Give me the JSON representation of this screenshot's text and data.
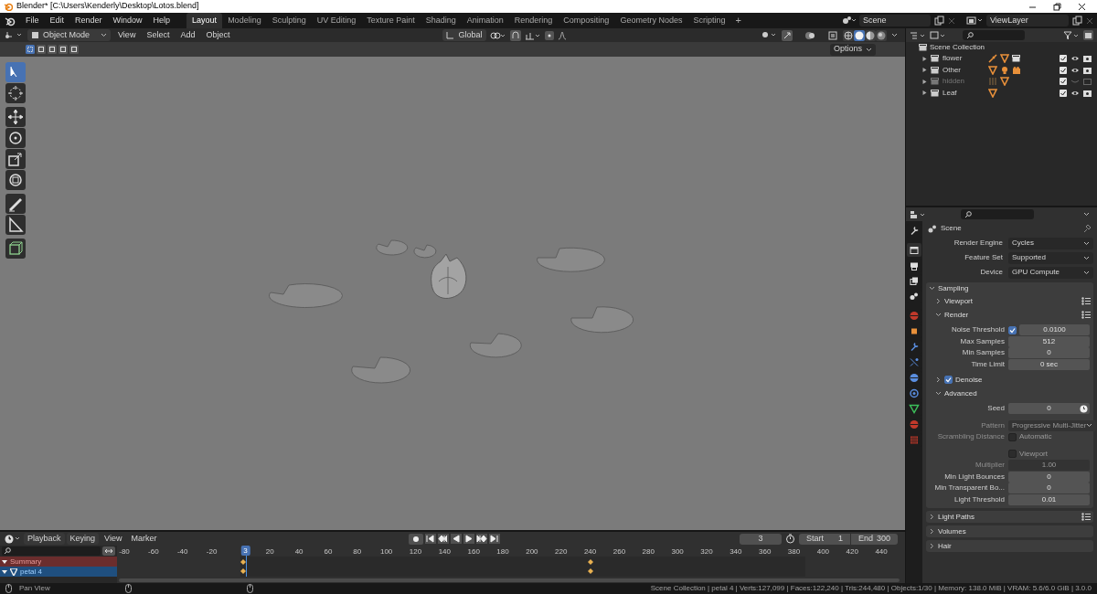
{
  "window": {
    "title": "Blender* [C:\\Users\\Kenderly\\Desktop\\Lotos.blend]"
  },
  "menus": [
    "File",
    "Edit",
    "Render",
    "Window",
    "Help"
  ],
  "workspaces": [
    {
      "label": "Layout",
      "selected": true
    },
    {
      "label": "Modeling",
      "selected": false
    },
    {
      "label": "Sculpting",
      "selected": false
    },
    {
      "label": "UV Editing",
      "selected": false
    },
    {
      "label": "Texture Paint",
      "selected": false
    },
    {
      "label": "Shading",
      "selected": false
    },
    {
      "label": "Animation",
      "selected": false
    },
    {
      "label": "Rendering",
      "selected": false
    },
    {
      "label": "Compositing",
      "selected": false
    },
    {
      "label": "Geometry Nodes",
      "selected": false
    },
    {
      "label": "Scripting",
      "selected": false
    }
  ],
  "add_workspace": "+",
  "scene": {
    "value": "Scene"
  },
  "view_layer": {
    "value": "ViewLayer"
  },
  "viewport": {
    "mode": "Object Mode",
    "menus": [
      "View",
      "Select",
      "Add",
      "Object"
    ],
    "orientation": "Global",
    "options": "Options",
    "select_modes": [
      {
        "selected": true
      },
      {
        "selected": false
      },
      {
        "selected": false
      },
      {
        "selected": false
      },
      {
        "selected": false
      }
    ],
    "shading_modes": [
      {
        "selected": false
      },
      {
        "selected": true
      },
      {
        "selected": false
      },
      {
        "selected": false
      }
    ],
    "tools": [
      {
        "kind": "select",
        "selected": true
      },
      {
        "kind": "cursor",
        "selected": false
      },
      {
        "kind": "move",
        "selected": false
      },
      {
        "kind": "rotate",
        "selected": false
      },
      {
        "kind": "scale",
        "selected": false
      },
      {
        "kind": "transform",
        "selected": false
      },
      {
        "kind": "annotate",
        "selected": false
      },
      {
        "kind": "measure",
        "selected": false
      },
      {
        "kind": "add-cube",
        "selected": false
      }
    ]
  },
  "outliner": {
    "root": "Scene Collection",
    "collections": [
      {
        "name": "flower",
        "expanded": false,
        "checked": true,
        "visible": true,
        "contents": [
          {
            "kind": "armature"
          },
          {
            "kind": "mesh"
          },
          {
            "kind": "collection"
          }
        ]
      },
      {
        "name": "Other",
        "expanded": false,
        "checked": true,
        "visible": true,
        "contents": [
          {
            "kind": "mesh"
          },
          {
            "kind": "light"
          },
          {
            "kind": "camera"
          }
        ]
      },
      {
        "name": "hidden",
        "expanded": false,
        "checked": true,
        "visible": false,
        "contents": [
          {
            "kind": "hair"
          },
          {
            "kind": "mesh"
          }
        ]
      },
      {
        "name": "Leaf",
        "expanded": false,
        "checked": true,
        "visible": true,
        "contents": [
          {
            "kind": "mesh"
          }
        ]
      }
    ]
  },
  "properties": {
    "tabs": [
      {
        "kind": "tool",
        "selected": false
      },
      {
        "kind": "render",
        "selected": true
      },
      {
        "kind": "output",
        "selected": false
      },
      {
        "kind": "view-layer",
        "selected": false
      },
      {
        "kind": "scene",
        "selected": false
      },
      {
        "kind": "world",
        "selected": false
      },
      {
        "kind": "object",
        "selected": false
      },
      {
        "kind": "modifiers",
        "selected": false
      },
      {
        "kind": "particles",
        "selected": false
      },
      {
        "kind": "physics",
        "selected": false
      },
      {
        "kind": "constraints",
        "selected": false
      },
      {
        "kind": "data",
        "selected": false
      },
      {
        "kind": "material",
        "selected": false
      },
      {
        "kind": "texture",
        "selected": false
      }
    ],
    "context": "Scene",
    "top_rows": [
      {
        "label": "Render Engine",
        "value": "Cycles"
      },
      {
        "label": "Feature Set",
        "value": "Supported"
      },
      {
        "label": "Device",
        "value": "GPU Compute"
      }
    ],
    "panels": [
      {
        "title": "Sampling",
        "expanded": true,
        "subpanels": [
          {
            "title": "Viewport",
            "expanded": false,
            "presets": true
          },
          {
            "title": "Render",
            "expanded": true,
            "presets": true,
            "rows": [
              {
                "kind": "check-number",
                "label": "Noise Threshold",
                "checked": true,
                "value": "0.0100",
                "disabled": false
              },
              {
                "kind": "number",
                "label": "Max Samples",
                "value": "512",
                "disabled": false
              },
              {
                "kind": "number",
                "label": "Min Samples",
                "value": "0",
                "disabled": false
              },
              {
                "kind": "number",
                "label": "Time Limit",
                "value": "0 sec",
                "disabled": false
              }
            ]
          },
          {
            "title": "Denoise",
            "expanded": false,
            "presets": false,
            "checked": true
          },
          {
            "title": "Advanced",
            "expanded": true,
            "presets": false,
            "rows": [
              {
                "kind": "number-toggle",
                "label": "Seed",
                "value": "0",
                "disabled": false
              },
              {
                "kind": "dropdown",
                "label": "Pattern",
                "value": "Progressive Multi-Jitter",
                "disabled": true
              },
              {
                "kind": "checkbox",
                "label": "Scrambling Distance",
                "text": "Automatic",
                "checked": false,
                "disabled": true
              },
              {
                "kind": "checkbox",
                "text": "Viewport",
                "checked": false,
                "disabled": true
              },
              {
                "kind": "number",
                "label": "Multiplier",
                "value": "1.00",
                "disabled": true
              },
              {
                "kind": "number",
                "label": "Min Light Bounces",
                "value": "0",
                "disabled": false
              },
              {
                "kind": "number",
                "label": "Min Transparent Bo...",
                "value": "0",
                "disabled": false
              },
              {
                "kind": "number",
                "label": "Light Threshold",
                "value": "0.01",
                "disabled": false
              }
            ]
          }
        ]
      },
      {
        "title": "Light Paths",
        "expanded": false,
        "presets": true
      },
      {
        "title": "Volumes",
        "expanded": false,
        "presets": false
      },
      {
        "title": "Hair",
        "expanded": false,
        "presets": false
      }
    ]
  },
  "timeline": {
    "menus": [
      "Playback",
      "Keying",
      "View",
      "Marker"
    ],
    "current_frame": "3",
    "start_label": "Start",
    "start": "1",
    "end_label": "End",
    "end": "300",
    "ruler": [
      "-80",
      "-60",
      "-40",
      "-20",
      "20",
      "40",
      "60",
      "80",
      "100",
      "120",
      "140",
      "160",
      "180",
      "200",
      "220",
      "240",
      "260",
      "280",
      "300",
      "320",
      "340",
      "360",
      "380",
      "400",
      "420",
      "440"
    ],
    "playhead": {
      "label": "3",
      "level": 0.163
    },
    "channels": [
      {
        "name": "Summary",
        "kind": "summary",
        "expanded": true
      },
      {
        "name": "petal 4",
        "kind": "object",
        "expanded": true
      }
    ],
    "keyframes": [
      {
        "level": 0.16
      },
      {
        "level": 0.601
      }
    ]
  },
  "status_bar": {
    "hint": "Pan View",
    "stats": "Scene Collection | petal 4 | Verts:127,099 | Faces:122,240 | Tris:244,480 | Objects:1/30 | Memory: 138.0 MiB | VRAM: 5.6/6.0 GiB | 3.0.0"
  }
}
